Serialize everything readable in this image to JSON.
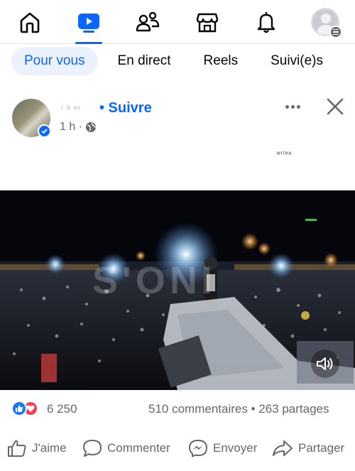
{
  "nav": {
    "items": [
      {
        "name": "home",
        "icon": "home-icon"
      },
      {
        "name": "video",
        "icon": "video-play-icon"
      },
      {
        "name": "friends",
        "icon": "friends-icon"
      },
      {
        "name": "marketplace",
        "icon": "marketplace-icon"
      },
      {
        "name": "notifications",
        "icon": "bell-icon"
      },
      {
        "name": "profile-menu",
        "icon": "avatar-icon"
      }
    ],
    "active": "video",
    "accent_color": "#0866ff"
  },
  "tabs": {
    "items": [
      "Pour vous",
      "En direct",
      "Reels",
      "Suivi(e)s"
    ],
    "active_index": 0
  },
  "post": {
    "author_blurred": "ᵗ ᵈ ᵉᵛ",
    "follow_label": "• Suivre",
    "time": "1 h ·",
    "privacy_icon": "globe-icon",
    "caption_blurred": "ʷᶦᵗᵉᵃ",
    "video": {
      "watermark": "S'ONI",
      "sound_icon": "speaker-icon"
    },
    "reactions": {
      "types": [
        "like",
        "love"
      ],
      "count": "6 250"
    },
    "comments_shares": "510 commentaires • 263 partages",
    "actions": {
      "like": "J'aime",
      "comment": "Commenter",
      "send": "Envoyer",
      "share": "Partager"
    }
  }
}
